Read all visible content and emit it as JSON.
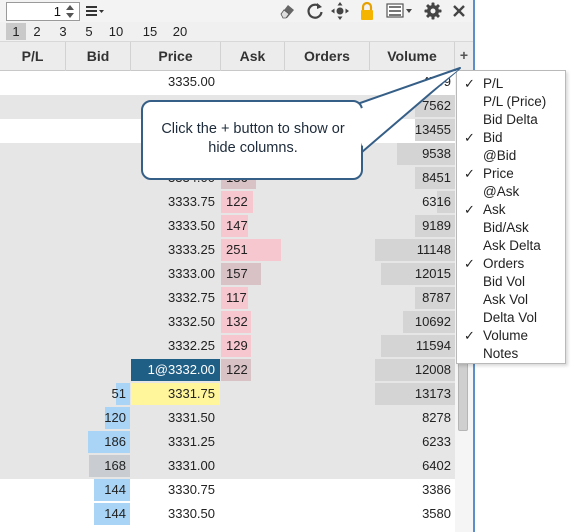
{
  "toolbar": {
    "quantity": "1",
    "icons": [
      "menu-icon",
      "eraser-icon",
      "refresh-icon",
      "center-icon",
      "lock-icon",
      "layout-icon",
      "gear-icon",
      "close-icon"
    ]
  },
  "presets": [
    "1",
    "2",
    "3",
    "5",
    "10",
    "15",
    "20"
  ],
  "header": {
    "pl": "P/L",
    "bid": "Bid",
    "price": "Price",
    "ask": "Ask",
    "orders": "Orders",
    "volume": "Volume",
    "toggle": "+"
  },
  "rows": [
    {
      "price": "3335.00",
      "bid": "",
      "ask": "",
      "volume": "4799"
    },
    {
      "price": "",
      "bid": "",
      "ask": "",
      "volume": "7562"
    },
    {
      "price": "",
      "bid": "",
      "ask": "",
      "volume": "13455"
    },
    {
      "price": "",
      "bid": "",
      "ask": "",
      "volume": "9538"
    },
    {
      "price": "3334.00",
      "bid": "",
      "ask": "136",
      "volume": "8451"
    },
    {
      "price": "3333.75",
      "bid": "",
      "ask": "122",
      "volume": "6316"
    },
    {
      "price": "3333.50",
      "bid": "",
      "ask": "147",
      "volume": "9189"
    },
    {
      "price": "3333.25",
      "bid": "",
      "ask": "251",
      "volume": "11148"
    },
    {
      "price": "3333.00",
      "bid": "",
      "ask": "157",
      "volume": "12015"
    },
    {
      "price": "3332.75",
      "bid": "",
      "ask": "117",
      "volume": "8787"
    },
    {
      "price": "3332.50",
      "bid": "",
      "ask": "132",
      "volume": "10692"
    },
    {
      "price": "3332.25",
      "bid": "",
      "ask": "129",
      "volume": "11594"
    },
    {
      "price": "1@3332.00",
      "bid": "",
      "ask": "122",
      "volume": "12008"
    },
    {
      "price": "3331.75",
      "bid": "51",
      "ask": "",
      "volume": "13173"
    },
    {
      "price": "3331.50",
      "bid": "120",
      "ask": "",
      "volume": "8278"
    },
    {
      "price": "3331.25",
      "bid": "186",
      "ask": "",
      "volume": "6233"
    },
    {
      "price": "3331.00",
      "bid": "168",
      "ask": "",
      "volume": "6402"
    },
    {
      "price": "3330.75",
      "bid": "144",
      "ask": "",
      "volume": "3386"
    },
    {
      "price": "3330.50",
      "bid": "144",
      "ask": "",
      "volume": "3580"
    }
  ],
  "column_menu": [
    {
      "label": "P/L",
      "checked": true
    },
    {
      "label": "P/L (Price)",
      "checked": false
    },
    {
      "label": "Bid Delta",
      "checked": false
    },
    {
      "label": "Bid",
      "checked": true
    },
    {
      "label": "@Bid",
      "checked": false
    },
    {
      "label": "Price",
      "checked": true
    },
    {
      "label": "@Ask",
      "checked": false
    },
    {
      "label": "Ask",
      "checked": true
    },
    {
      "label": "Bid/Ask",
      "checked": false
    },
    {
      "label": "Ask Delta",
      "checked": false
    },
    {
      "label": "Orders",
      "checked": true
    },
    {
      "label": "Bid Vol",
      "checked": false
    },
    {
      "label": "Ask Vol",
      "checked": false
    },
    {
      "label": "Delta Vol",
      "checked": false
    },
    {
      "label": "Volume",
      "checked": true
    },
    {
      "label": "Notes",
      "checked": false
    }
  ],
  "check_mark": "✓",
  "callout": {
    "text": "Click the + button to show or hide columns."
  },
  "colors": {
    "order_highlight": "#1f5f86",
    "last_price": "#fff59a",
    "bid_bar": "#a9d4f5",
    "ask_bar": "#f7c7cf",
    "callout_border": "#365f87"
  }
}
